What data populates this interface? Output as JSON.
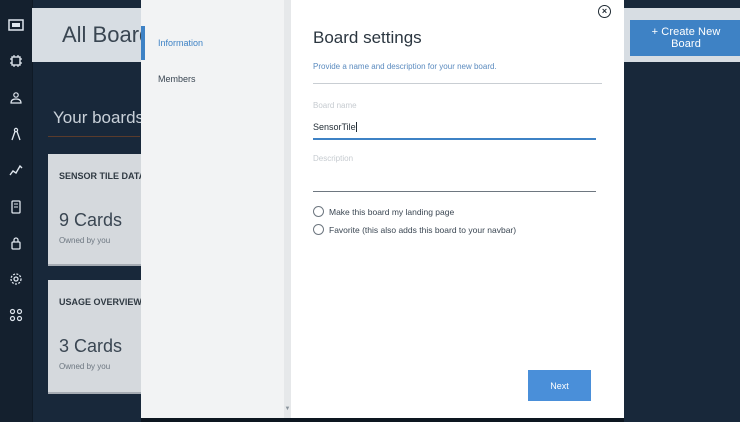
{
  "sidebar": {
    "icons": [
      "monitor-icon",
      "chip-icon",
      "users-icon",
      "compass-icon",
      "activity-icon",
      "device-icon",
      "lock-icon",
      "settings-icon",
      "connections-icon"
    ]
  },
  "header": {
    "title": "All Boards",
    "create_button": "+ Create New Board"
  },
  "section": {
    "title": "Your boards"
  },
  "cards": [
    {
      "title": "SENSOR TILE DATA",
      "count": "9 Cards",
      "owner": "Owned by you"
    },
    {
      "title": "USAGE OVERVIEW",
      "count": "3 Cards",
      "owner": "Owned by you"
    }
  ],
  "modal": {
    "nav": {
      "items": [
        "Information",
        "Members"
      ]
    },
    "title": "Board settings",
    "subtitle": "Provide a name and description for your new board.",
    "board_name": {
      "label": "Board name",
      "value": "SensorTile"
    },
    "description": {
      "label": "Description",
      "value": ""
    },
    "options": [
      "Make this board my landing page",
      "Favorite (this also adds this board to your navbar)"
    ],
    "next_button": "Next",
    "close_symbol": "×"
  }
}
